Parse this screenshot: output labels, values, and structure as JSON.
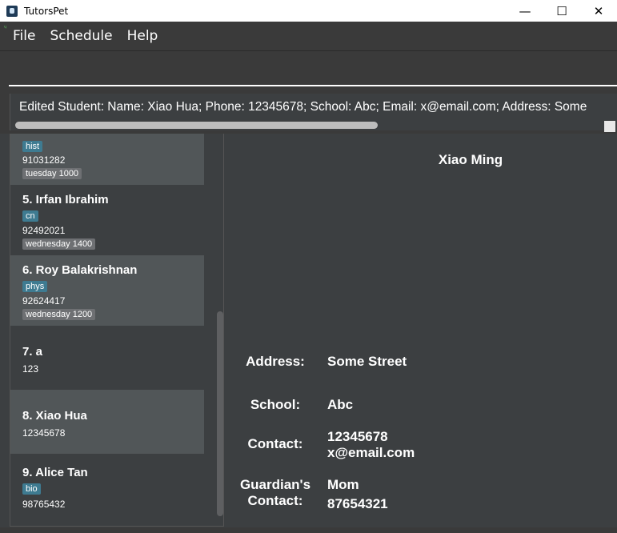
{
  "window": {
    "title": "TutorsPet",
    "minimize_glyph": "—",
    "maximize_glyph": "☐",
    "close_glyph": "✕"
  },
  "menu": {
    "items": [
      {
        "label": "File"
      },
      {
        "label": "Schedule"
      },
      {
        "label": "Help"
      }
    ]
  },
  "command": {
    "value": "",
    "placeholder": ""
  },
  "result": {
    "text": "Edited Student: Name: Xiao Hua; Phone: 12345678; School: Abc; Email: x@email.com; Address: Some"
  },
  "students": [
    {
      "index_name": "",
      "subject": "hist",
      "phone": "91031282",
      "lesson": "tuesday 1000"
    },
    {
      "index_name": "5.  Irfan Ibrahim",
      "subject": "cn",
      "phone": "92492021",
      "lesson": "wednesday 1400"
    },
    {
      "index_name": "6.  Roy Balakrishnan",
      "subject": "phys",
      "phone": "92624417",
      "lesson": "wednesday 1200"
    },
    {
      "index_name": "7.  a",
      "subject": "",
      "phone": "123",
      "lesson": ""
    },
    {
      "index_name": "8.  Xiao Hua",
      "subject": "",
      "phone": "12345678",
      "lesson": ""
    },
    {
      "index_name": "9.  Alice Tan",
      "subject": "bio",
      "phone": "98765432",
      "lesson": ""
    }
  ],
  "detail": {
    "name": "Xiao Ming",
    "address_label": "Address:",
    "address_value": "Some Street",
    "school_label": "School:",
    "school_value": "Abc",
    "contact_label": "Contact:",
    "contact_phone": "12345678",
    "contact_email": "x@email.com",
    "guardian_label_1": "Guardian's",
    "guardian_label_2": "Contact:",
    "guardian_name": "Mom",
    "guardian_phone": "87654321"
  },
  "colors": {
    "background": "#3c3f41",
    "card_alt": "#515658",
    "subject_tag": "#3e7b91",
    "lesson_tag": "#6e7073"
  }
}
